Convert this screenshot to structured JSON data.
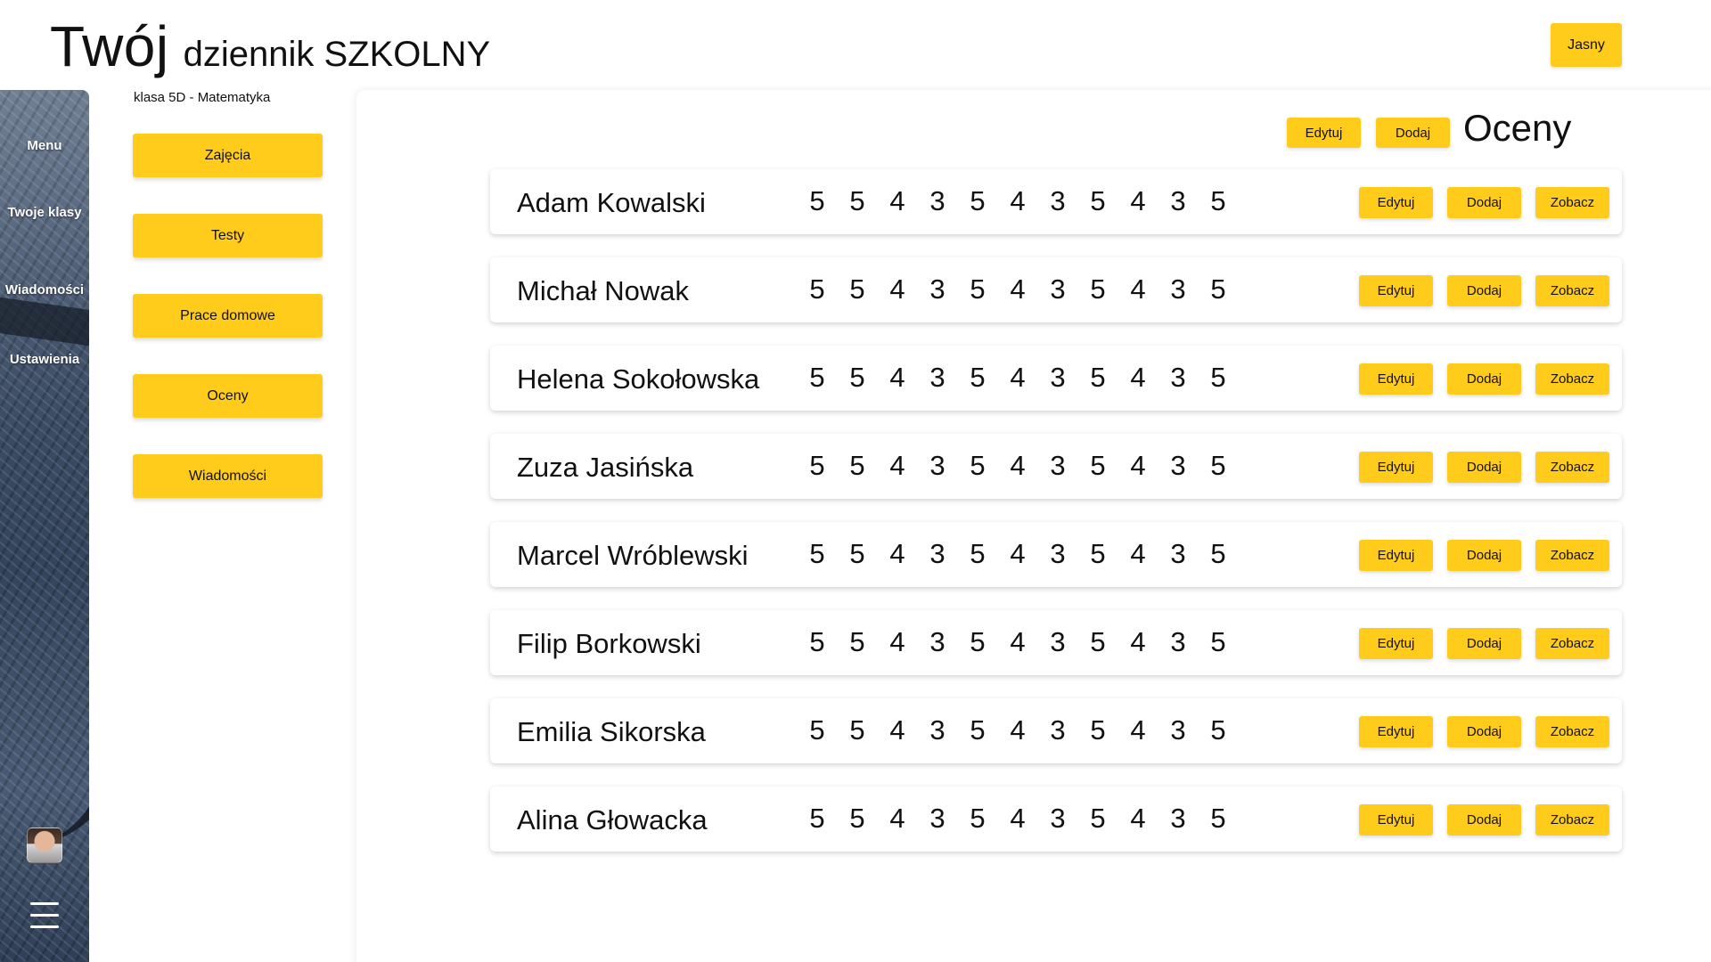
{
  "header": {
    "logo_big": "Twój",
    "logo_small": "dziennik SZKOLNY",
    "theme_button": "Jasny"
  },
  "sidebar": {
    "items": [
      {
        "label": "Menu"
      },
      {
        "label": "Twoje klasy"
      },
      {
        "label": "Wiadomości"
      },
      {
        "label": "Ustawienia"
      }
    ],
    "avatar": "avatar",
    "menu_icon": "hamburger-icon"
  },
  "subnav": {
    "class_label": "klasa 5D - Matematyka",
    "buttons": [
      {
        "label": "Zajęcia"
      },
      {
        "label": "Testy"
      },
      {
        "label": "Prace domowe"
      },
      {
        "label": "Oceny"
      },
      {
        "label": "Wiadomości"
      }
    ]
  },
  "main": {
    "title": "Oceny",
    "edit_label": "Edytuj",
    "add_label": "Dodaj",
    "students": [
      {
        "name": "Adam Kowalski",
        "grades": [
          "5",
          "5",
          "4",
          "3",
          "5",
          "4",
          "3",
          "5",
          "4",
          "3",
          "5"
        ]
      },
      {
        "name": "Michał Nowak",
        "grades": [
          "5",
          "5",
          "4",
          "3",
          "5",
          "4",
          "3",
          "5",
          "4",
          "3",
          "5"
        ]
      },
      {
        "name": "Helena Sokołowska",
        "grades": [
          "5",
          "5",
          "4",
          "3",
          "5",
          "4",
          "3",
          "5",
          "4",
          "3",
          "5"
        ]
      },
      {
        "name": "Zuza Jasińska",
        "grades": [
          "5",
          "5",
          "4",
          "3",
          "5",
          "4",
          "3",
          "5",
          "4",
          "3",
          "5"
        ]
      },
      {
        "name": "Marcel Wróblewski",
        "grades": [
          "5",
          "5",
          "4",
          "3",
          "5",
          "4",
          "3",
          "5",
          "4",
          "3",
          "5"
        ]
      },
      {
        "name": "Filip Borkowski",
        "grades": [
          "5",
          "5",
          "4",
          "3",
          "5",
          "4",
          "3",
          "5",
          "4",
          "3",
          "5"
        ]
      },
      {
        "name": "Emilia Sikorska",
        "grades": [
          "5",
          "5",
          "4",
          "3",
          "5",
          "4",
          "3",
          "5",
          "4",
          "3",
          "5"
        ]
      },
      {
        "name": "Alina Głowacka",
        "grades": [
          "5",
          "5",
          "4",
          "3",
          "5",
          "4",
          "3",
          "5",
          "4",
          "3",
          "5"
        ]
      }
    ],
    "row_actions": {
      "edit": "Edytuj",
      "add": "Dodaj",
      "view": "Zobacz"
    }
  },
  "colors": {
    "accent": "#ffcc1b"
  }
}
